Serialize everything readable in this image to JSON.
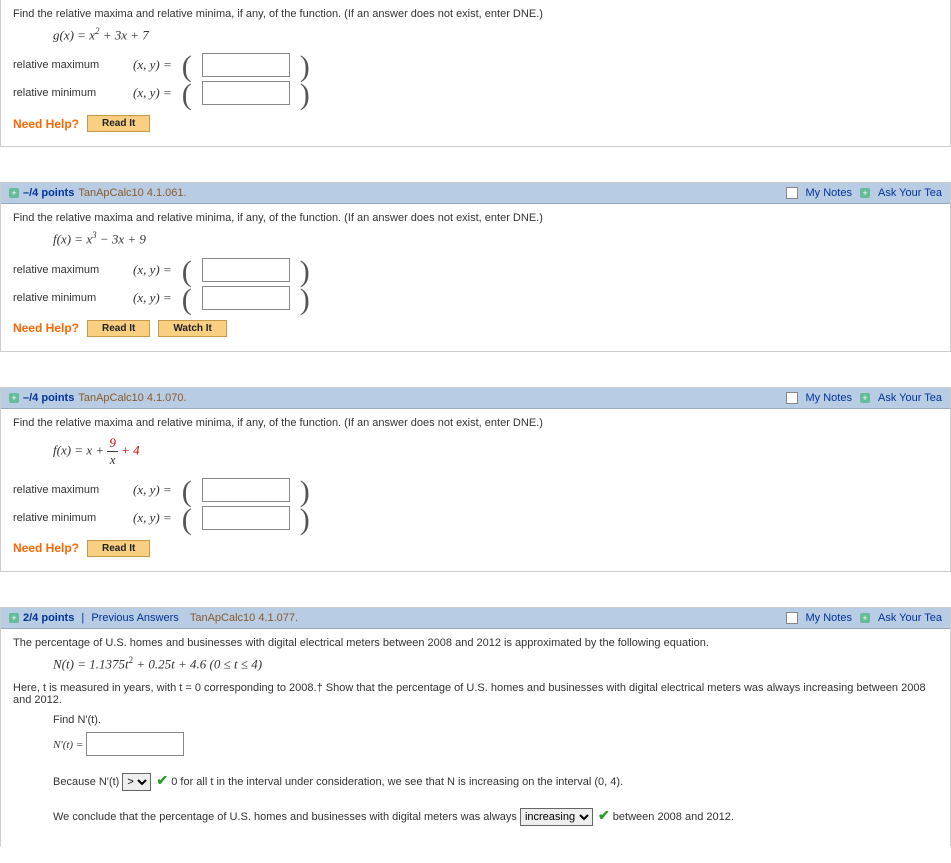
{
  "q1": {
    "prompt": "Find the relative maxima and relative minima, if any, of the function. (If an answer does not exist, enter DNE.)",
    "eq_lhs": "g(x) = ",
    "eq_rhs_a": "x",
    "eq_rhs_exp": "2",
    "eq_rhs_b": " + 3x + 7",
    "relmax_label": "relative maximum",
    "relmin_label": "relative minimum",
    "xy_eq": "(x, y) = ",
    "need_help": "Need Help?",
    "read_it": "Read It"
  },
  "q2": {
    "hdr_points": "–/4 points",
    "hdr_ref": "TanApCalc10 4.1.061.",
    "my_notes": "My Notes",
    "ask": "Ask Your Tea",
    "prompt": "Find the relative maxima and relative minima, if any, of the function. (If an answer does not exist, enter DNE.)",
    "eq_lhs": "f(x) = ",
    "eq_rhs_a": "x",
    "eq_rhs_exp": "3",
    "eq_rhs_b": " − 3x + 9",
    "relmax_label": "relative maximum",
    "relmin_label": "relative minimum",
    "xy_eq": "(x, y) = ",
    "need_help": "Need Help?",
    "read_it": "Read It",
    "watch_it": "Watch It"
  },
  "q3": {
    "hdr_points": "–/4 points",
    "hdr_ref": "TanApCalc10 4.1.070.",
    "my_notes": "My Notes",
    "ask": "Ask Your Tea",
    "prompt": "Find the relative maxima and relative minima, if any, of the function. (If an answer does not exist, enter DNE.)",
    "eq_lhs": "f(x) = x + ",
    "frac_num": "9",
    "frac_den": "x",
    "eq_tail": " + 4",
    "relmax_label": "relative maximum",
    "relmin_label": "relative minimum",
    "xy_eq": "(x, y) = ",
    "need_help": "Need Help?",
    "read_it": "Read It"
  },
  "q4": {
    "hdr_points": "2/4 points",
    "hdr_prev": "Previous Answers",
    "hdr_ref": "TanApCalc10 4.1.077.",
    "my_notes": "My Notes",
    "ask": "Ask Your Tea",
    "p1": "The percentage of U.S. homes and businesses with digital electrical meters between 2008 and 2012 is approximated by the following equation.",
    "eq_lhs": "N(t) = 1.1375",
    "eq_var": "t",
    "eq_exp": "2",
    "eq_tail": " + 0.25t + 4.6    (0 ≤ t ≤ 4)",
    "p2": "Here, t is measured in years, with  t = 0  corresponding to 2008.† Show that the percentage of U.S. homes and businesses with digital electrical meters was always increasing between 2008 and 2012.",
    "find_line": "Find  N'(t).",
    "nprime_lhs": "N'(t)  = ",
    "because_pre": "Because  N'(t) ",
    "sel1_value": ">",
    "because_mid": "  0  for all t in the interval under consideration, we see that N is increasing on the interval  (0, 4).",
    "conclude_pre": "We conclude that the percentage of U.S. homes and businesses with digital meters was always ",
    "sel2_value": "increasing",
    "conclude_post": " between 2008 and 2012."
  }
}
